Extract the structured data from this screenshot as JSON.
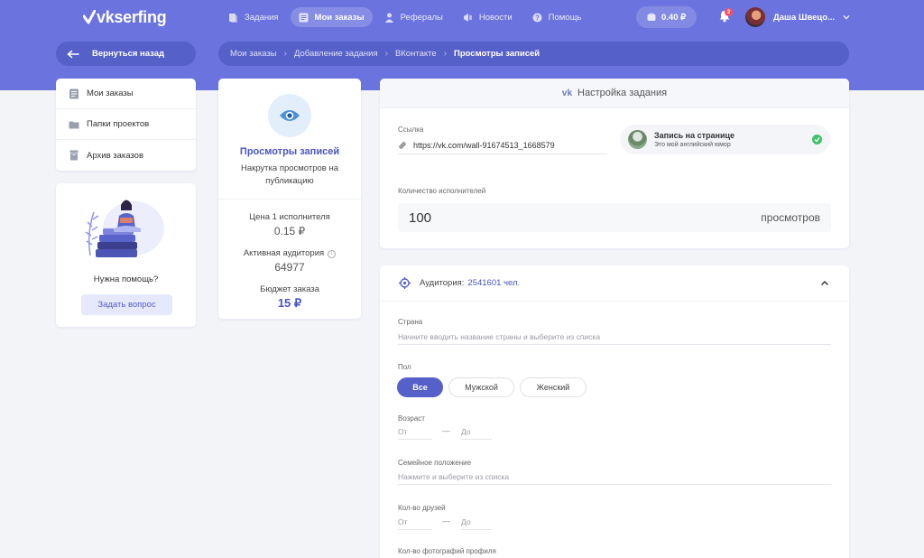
{
  "brand": {
    "name": "vkserfing"
  },
  "nav": [
    {
      "label": "Задания",
      "icon": "tasks-icon",
      "active": false
    },
    {
      "label": "Мои заказы",
      "icon": "orders-icon",
      "active": true
    },
    {
      "label": "Рефералы",
      "icon": "referrals-icon",
      "active": false
    },
    {
      "label": "Новости",
      "icon": "news-icon",
      "active": false
    },
    {
      "label": "Помощь",
      "icon": "help-icon",
      "active": false
    }
  ],
  "balance": "0.40 ₽",
  "notifications": "2",
  "user": {
    "name": "Даша Швецо..."
  },
  "back_label": "Вернуться назад",
  "breadcrumbs": [
    "Мои заказы",
    "Добавление задания",
    "ВКонтакте",
    "Просмотры записей"
  ],
  "sidebar": {
    "items": [
      {
        "label": "Мои заказы",
        "icon": "list-icon"
      },
      {
        "label": "Папки проектов",
        "icon": "folder-icon"
      },
      {
        "label": "Архив заказов",
        "icon": "archive-icon"
      }
    ],
    "help_title": "Нужна помощь?",
    "help_button": "Задать вопрос"
  },
  "task": {
    "title": "Просмотры записей",
    "description": "Накрутка просмотров на публикацию",
    "price_label": "Цена 1 исполнителя",
    "price_value": "0.15 ₽",
    "audience_label": "Активная аудитория",
    "audience_value": "64977",
    "budget_label": "Бюджет заказа",
    "budget_value": "15 ₽"
  },
  "settings": {
    "title": "Настройка задания",
    "link_label": "Ссылка",
    "link_value": "https://vk.com/wall-91674513_1668579",
    "post_title": "Запись на странице",
    "post_subtitle": "Это мой английский юмор",
    "qty_label": "Количество исполнителей",
    "qty_value": "100",
    "qty_unit": "просмотров"
  },
  "audience": {
    "label": "Аудитория:",
    "count": "2541601 чел.",
    "country_label": "Страна",
    "country_placeholder": "Начните вводить название страны и выберите из списка",
    "gender_label": "Пол",
    "gender_options": [
      "Все",
      "Мужской",
      "Женский"
    ],
    "age_label": "Возраст",
    "from": "От",
    "to": "До",
    "marital_label": "Семейное положение",
    "marital_placeholder": "Нажмите и выберите из списка",
    "friends_label": "Кол-во друзей",
    "photos_label": "Кол-во фотографий профиля"
  },
  "colors": {
    "accent": "#6b74de",
    "accent_dark": "#5560c9",
    "success": "#41c26a"
  }
}
